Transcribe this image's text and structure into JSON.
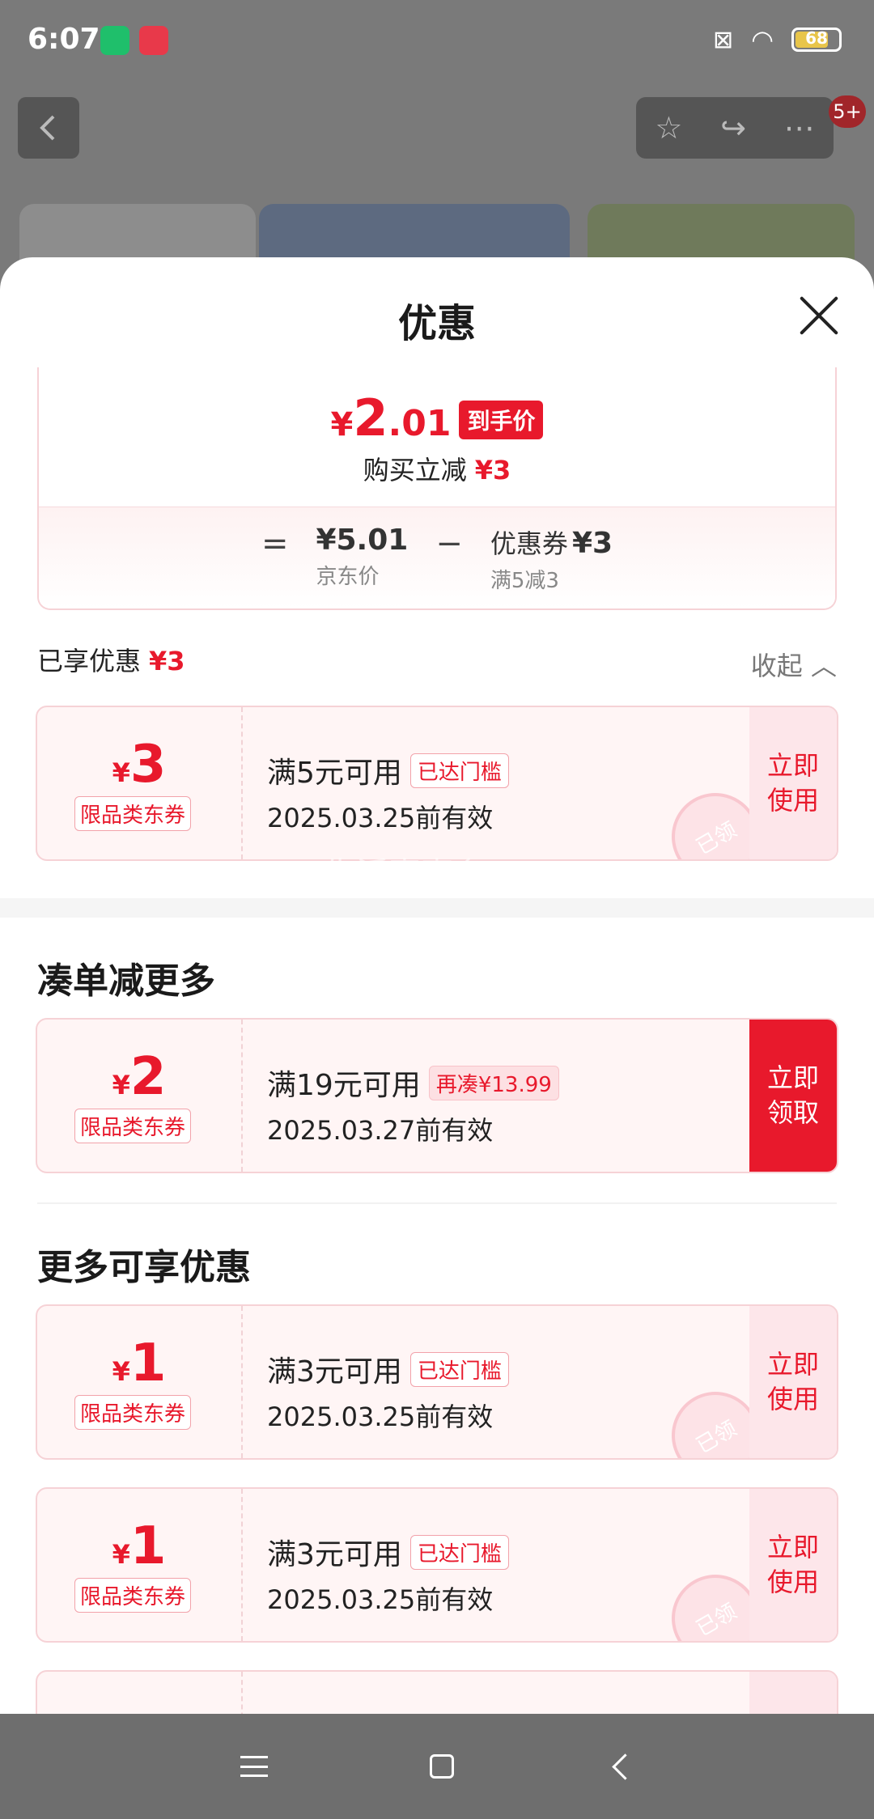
{
  "status_bar": {
    "time": "6:07",
    "battery": "68"
  },
  "header": {
    "badge": "5+"
  },
  "sheet": {
    "title": "优惠",
    "final_price": {
      "currency": "¥",
      "integer": "2",
      "decimal": ".01",
      "tag": "到手价"
    },
    "reduce": {
      "label": "购买立减",
      "amount": "¥3"
    },
    "formula": {
      "eq": "=",
      "jd_price": "¥5.01",
      "jd_price_label": "京东价",
      "minus": "−",
      "coupon_label": "优惠券",
      "coupon_value": "¥3",
      "coupon_rule": "满5减3"
    },
    "enjoyed": {
      "label": "已享优惠",
      "amount": "¥3",
      "collapse": "收起"
    },
    "enjoyed_coupon": {
      "currency": "¥",
      "amount": "3",
      "type": "限品类东券",
      "condition": "满5元可用",
      "chip": "已达门槛",
      "expiry": "2025.03.25前有效",
      "action": "立即\n使用",
      "stamp": "已领"
    },
    "combine_section": {
      "title": "凑单减更多",
      "coupon": {
        "currency": "¥",
        "amount": "2",
        "type": "限品类东券",
        "condition": "满19元可用",
        "chip": "再凑¥13.99",
        "expiry": "2025.03.27前有效",
        "action": "立即\n领取"
      }
    },
    "more_section": {
      "title": "更多可享优惠",
      "coupons": [
        {
          "currency": "¥",
          "amount": "1",
          "type": "限品类东券",
          "condition": "满3元可用",
          "chip": "已达门槛",
          "expiry": "2025.03.25前有效",
          "action": "立即\n使用",
          "stamp": "已领"
        },
        {
          "currency": "¥",
          "amount": "1",
          "type": "限品类东券",
          "condition": "满3元可用",
          "chip": "已达门槛",
          "expiry": "2025.03.25前有效",
          "action": "立即\n使用",
          "stamp": "已领"
        }
      ]
    },
    "watermark": "生活喜事多"
  },
  "colors": {
    "accent": "#e8192c",
    "card_bg": "#fff5f5",
    "overlay": "#7a7a7a"
  }
}
